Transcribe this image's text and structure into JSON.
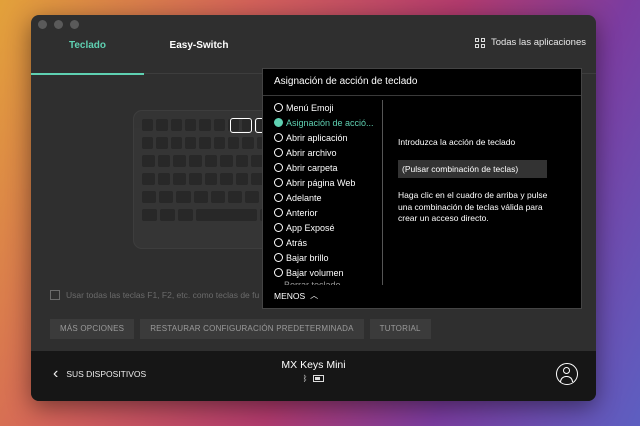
{
  "tabs": [
    {
      "label": "Teclado",
      "active": true
    },
    {
      "label": "Easy-Switch",
      "active": false
    }
  ],
  "all_apps": {
    "label": "Todas las aplicaciones",
    "icon": "grid-icon"
  },
  "main": {
    "use_fkeys_label": "Usar todas las teclas F1, F2, etc. como teclas de fu",
    "buttons": {
      "more_options": "MÁS OPCIONES",
      "restore": "RESTAURAR CONFIGURACIÓN PREDETERMINADA",
      "tutorial": "TUTORIAL"
    }
  },
  "panel": {
    "title": "Asignación de acción de teclado",
    "items": [
      {
        "label": "Menú Emoji",
        "selected": false
      },
      {
        "label": "Asignación de acció...",
        "selected": true
      },
      {
        "label": "Abrir aplicación",
        "selected": false
      },
      {
        "label": "Abrir archivo",
        "selected": false
      },
      {
        "label": "Abrir carpeta",
        "selected": false
      },
      {
        "label": "Abrir página Web",
        "selected": false
      },
      {
        "label": "Adelante",
        "selected": false
      },
      {
        "label": "Anterior",
        "selected": false
      },
      {
        "label": "App Exposé",
        "selected": false
      },
      {
        "label": "Atrás",
        "selected": false
      },
      {
        "label": "Bajar brillo",
        "selected": false
      },
      {
        "label": "Bajar volumen",
        "selected": false
      }
    ],
    "partial_item": "Borrar teclado",
    "instruction": "Introduzca la acción de teclado",
    "combo_placeholder": "(Pulsar combinación de teclas)",
    "help": "Haga clic en el cuadro de arriba y pulse una combinación de teclas válida para crear un acceso directo.",
    "menos": "MENOS"
  },
  "footer": {
    "back_label": "SUS DISPOSITIVOS",
    "device_name": "MX Keys Mini",
    "icons": [
      "bluetooth-icon",
      "battery-icon"
    ]
  },
  "colors": {
    "accent": "#5fd1b2",
    "window": "#2f2f2f",
    "panel": "#000000",
    "footer": "#161616"
  }
}
